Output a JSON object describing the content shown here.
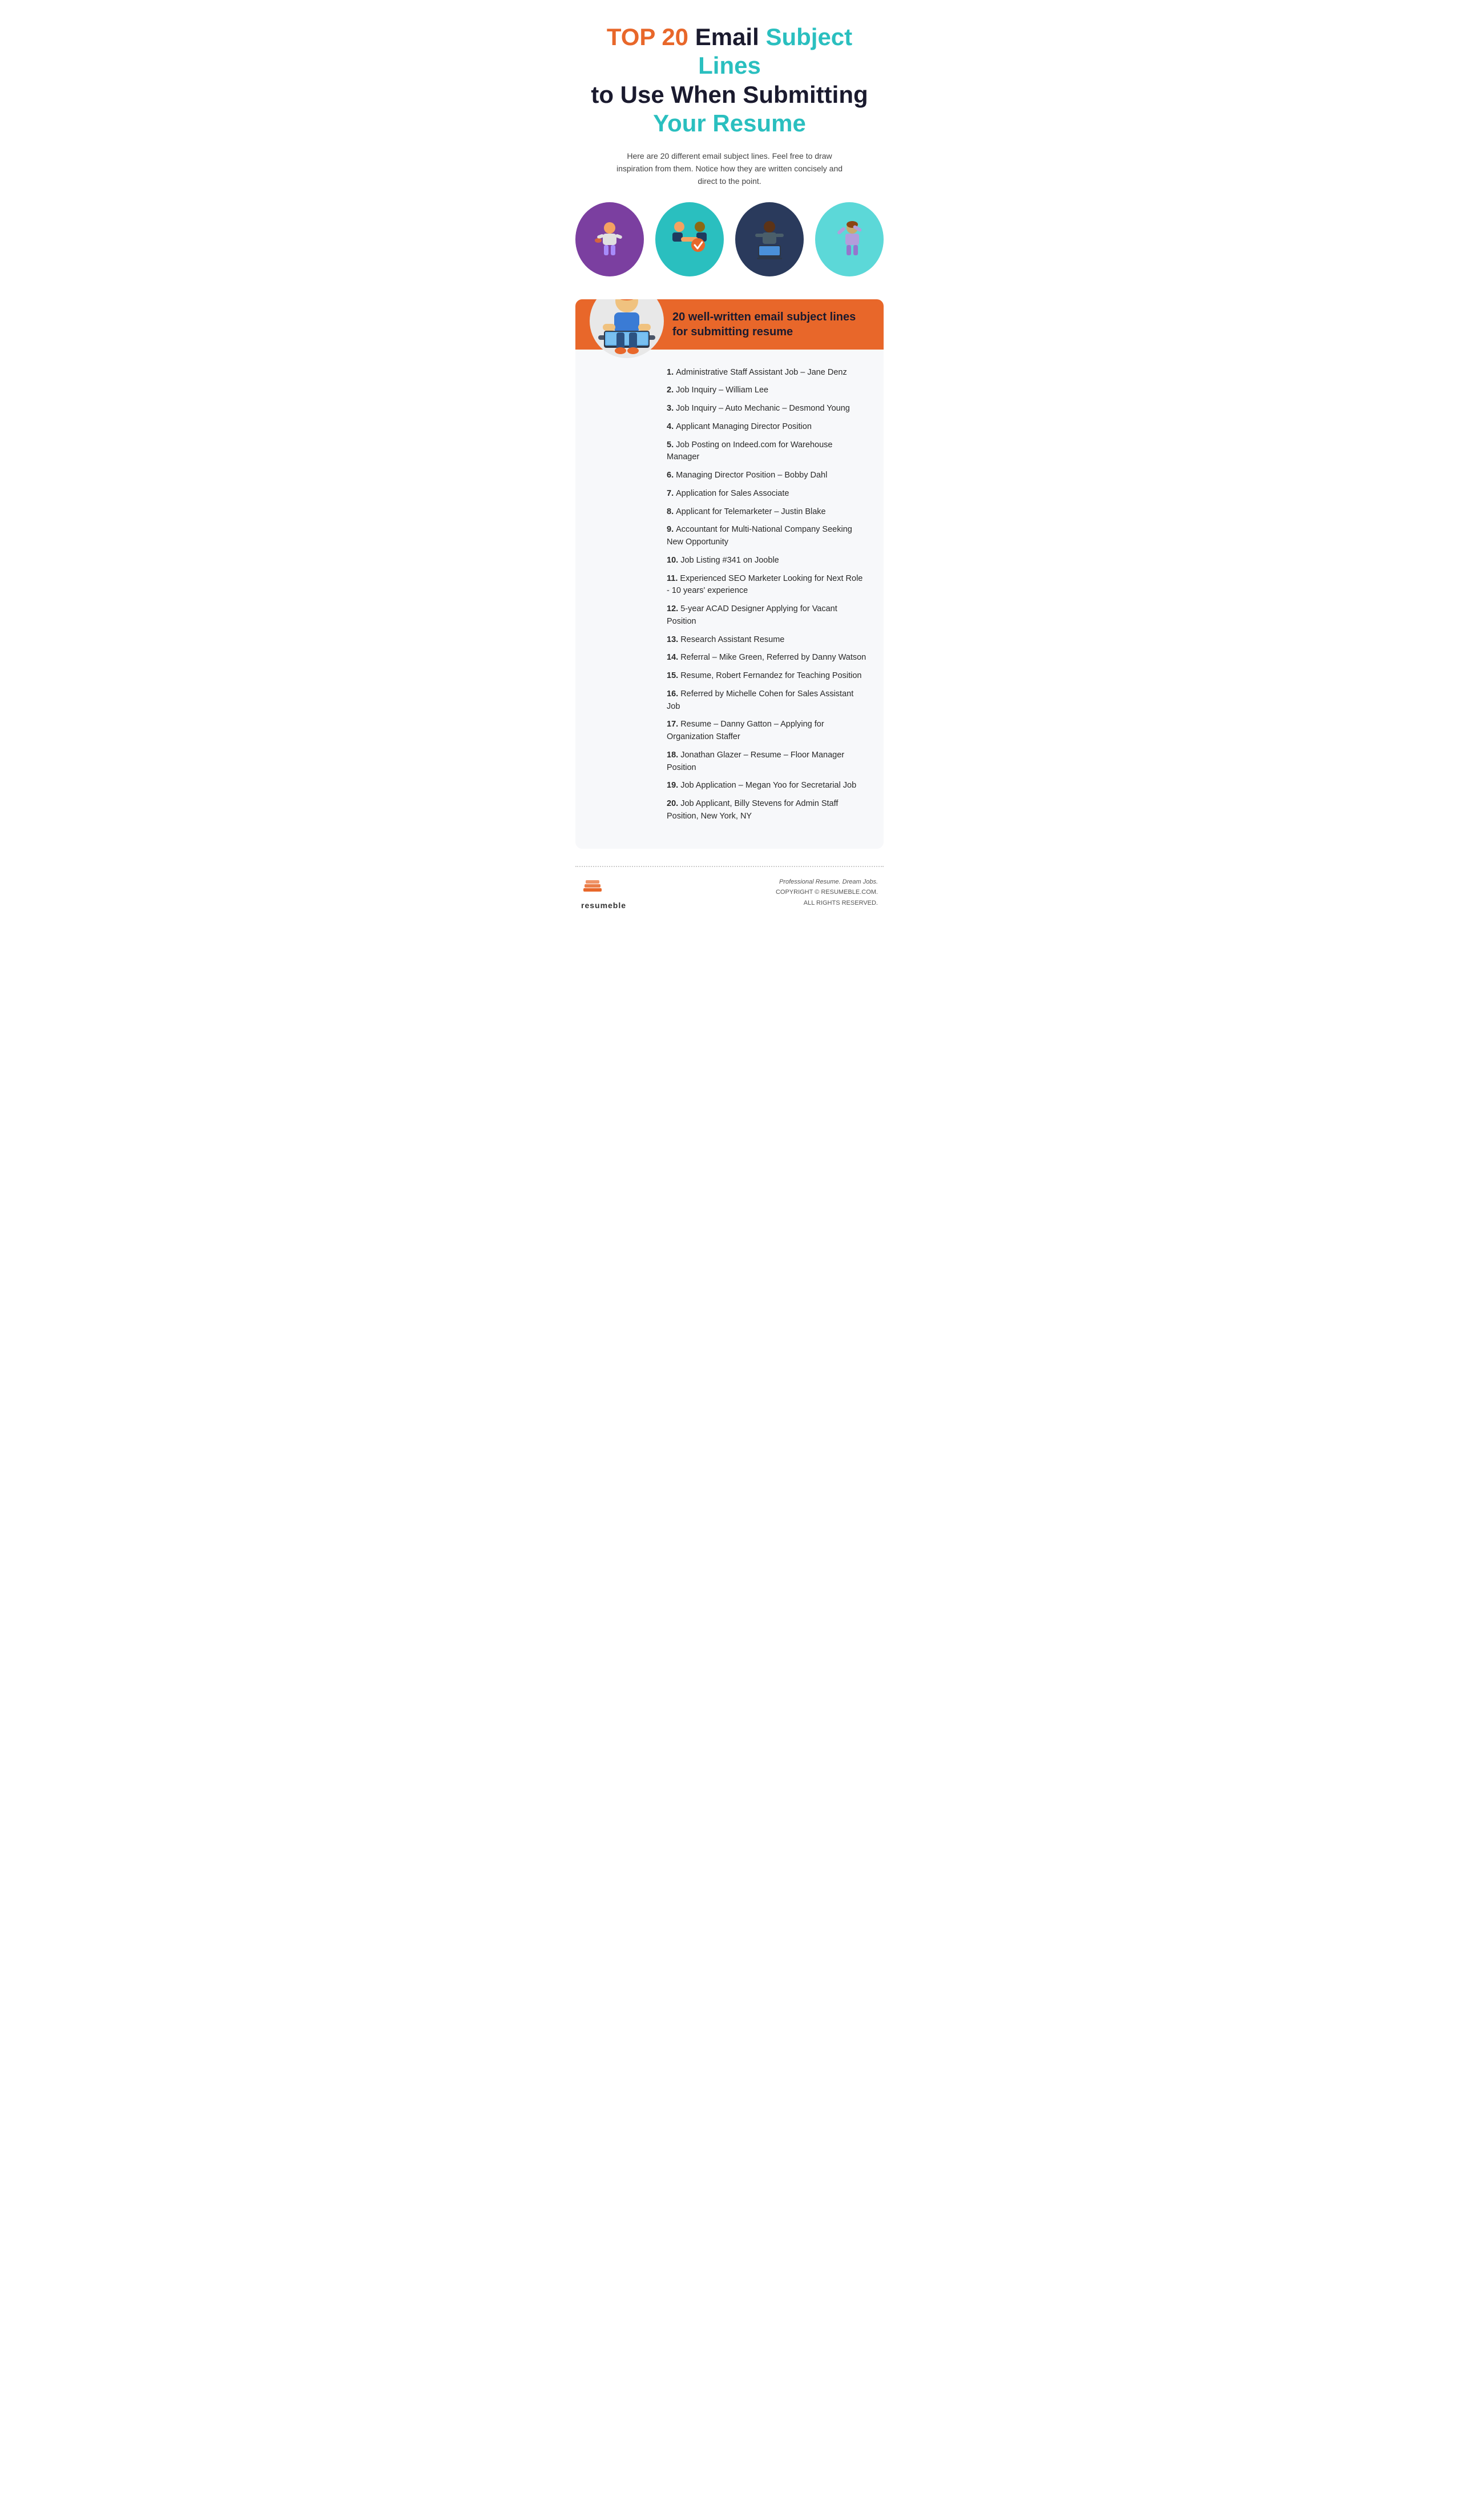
{
  "header": {
    "line1_part1": "TOP 20",
    "line1_part2": " Email ",
    "line1_part3": "Subject Lines",
    "line2": "to Use When Submitting",
    "line3": "Your Resume"
  },
  "subtitle": "Here are 20 different email subject lines. Feel free to draw inspiration from them. Notice how they are written concisely and direct to the point.",
  "illustrations": [
    {
      "id": "illus1",
      "bg": "purple-bg",
      "label": "person-working-illustration"
    },
    {
      "id": "illus2",
      "bg": "teal-bg",
      "label": "handshake-illustration"
    },
    {
      "id": "illus3",
      "bg": "dark-bg",
      "label": "person-sitting-illustration"
    },
    {
      "id": "illus4",
      "bg": "light-teal-bg",
      "label": "person-celebrating-illustration"
    }
  ],
  "box_header_title": "20 well-written email subject lines for submitting resume",
  "email_items": [
    "Administrative Staff Assistant Job – Jane Denz",
    "Job Inquiry – William Lee",
    "Job Inquiry – Auto Mechanic – Desmond Young",
    "Applicant Managing Director Position",
    "Job Posting on Indeed.com for Warehouse Manager",
    "Managing Director Position – Bobby Dahl",
    "Application for Sales Associate",
    "Applicant for Telemarketer – Justin Blake",
    "Accountant for Multi-National Company Seeking New Opportunity",
    "Job Listing #341 on Jooble",
    "Experienced SEO Marketer Looking for Next Role - 10 years' experience",
    "5-year ACAD Designer Applying for Vacant Position",
    "Research Assistant Resume",
    "Referral – Mike Green, Referred by Danny Watson",
    "Resume, Robert Fernandez for Teaching Position",
    "Referred by Michelle Cohen for Sales Assistant Job",
    "Resume – Danny Gatton – Applying for Organization Staffer",
    "Jonathan Glazer – Resume – Floor Manager Position",
    "Job Application – Megan Yoo for Secretarial Job",
    "Job Applicant, Billy Stevens for Admin Staff Position, New York, NY"
  ],
  "footer": {
    "logo_text": "resumeble",
    "tagline": "Professional Resume. Dream Jobs.",
    "copyright": "COPYRIGHT © RESUMEBLE.COM.",
    "rights": "ALL RIGHTS RESERVED."
  }
}
